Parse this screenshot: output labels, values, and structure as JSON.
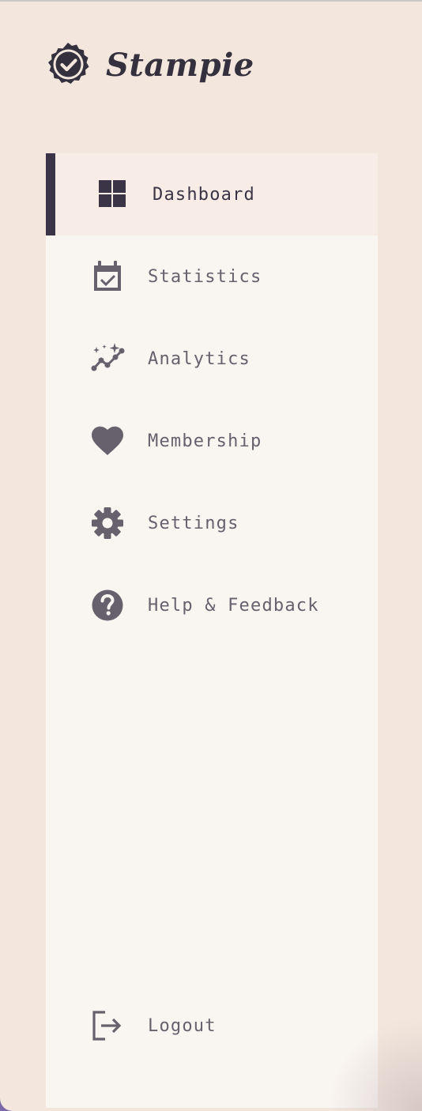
{
  "brand": {
    "name": "Stampie",
    "logo_icon": "badge-check-icon"
  },
  "nav": {
    "items": [
      {
        "label": "Dashboard",
        "icon": "dashboard-grid-icon",
        "active": true
      },
      {
        "label": "Statistics",
        "icon": "calendar-check-icon",
        "active": false
      },
      {
        "label": "Analytics",
        "icon": "sparkle-chart-icon",
        "active": false
      },
      {
        "label": "Membership",
        "icon": "heart-icon",
        "active": false
      },
      {
        "label": "Settings",
        "icon": "gear-icon",
        "active": false
      },
      {
        "label": "Help & Feedback",
        "icon": "help-circle-icon",
        "active": false
      }
    ],
    "logout": {
      "label": "Logout",
      "icon": "logout-icon"
    }
  },
  "colors": {
    "background": "#f3e7dd",
    "nav_background": "#f9f5f1",
    "active_background": "#f7ede6",
    "active_indicator": "#3a3446",
    "icon": "#66616d",
    "active_text": "#3a3446"
  }
}
